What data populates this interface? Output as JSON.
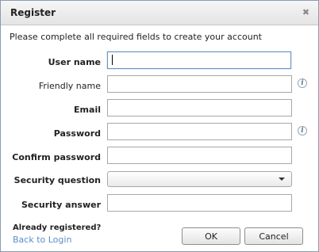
{
  "dialog": {
    "title": "Register",
    "instructions": "Please complete all required fields to create your account"
  },
  "fields": {
    "user_name": {
      "label": "User name",
      "value": ""
    },
    "friendly_name": {
      "label": "Friendly name",
      "value": ""
    },
    "email": {
      "label": "Email",
      "value": ""
    },
    "password": {
      "label": "Password",
      "value": ""
    },
    "confirm_password": {
      "label": "Confirm password",
      "value": ""
    },
    "security_question": {
      "label": "Security question",
      "value": ""
    },
    "security_answer": {
      "label": "Security answer",
      "value": ""
    }
  },
  "footer": {
    "already_registered": "Already registered?",
    "back_to_login": "Back to Login",
    "ok_label": "OK",
    "cancel_label": "Cancel"
  },
  "colors": {
    "link": "#5a8fc8",
    "focus_border": "#6a93c4"
  }
}
